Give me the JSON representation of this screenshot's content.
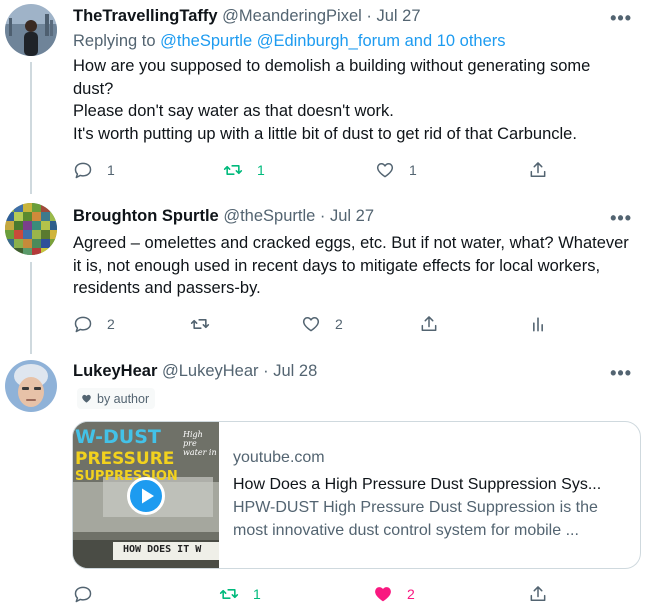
{
  "tweets": [
    {
      "name": "TheTravellingTaffy",
      "handle": "@MeanderingPixel",
      "separator": "·",
      "date": "Jul 27",
      "replying_prefix": "Replying to",
      "replying_to": "@theSpurtle @Edinburgh_forum and 10 others",
      "lines": [
        "How are you supposed to demolish a building without generating some dust?",
        "Please don't say water as that doesn't work.",
        "It's worth putting up with a little bit of dust to get rid of that Carbuncle."
      ],
      "reply_count": "1",
      "retweet_count": "1",
      "like_count": "1"
    },
    {
      "name": "Broughton Spurtle",
      "handle": "@theSpurtle",
      "separator": "·",
      "date": "Jul 27",
      "lines": [
        "Agreed – omelettes and cracked eggs, etc. But if not water, what? Whatever it is, not enough used in recent days to mitigate effects for local workers, residents and passers-by."
      ],
      "reply_count": "2",
      "retweet_count": "",
      "like_count": "2"
    },
    {
      "name": "LukeyHear",
      "handle": "@LukeyHear",
      "separator": "·",
      "date": "Jul 28",
      "badge": "by author",
      "card": {
        "domain": "youtube.com",
        "title": "How Does a High Pressure Dust Suppression Sys...",
        "description": "HPW-DUST High Pressure Dust Suppression is the most innovative dust control system for mobile ...",
        "thumb_title_1": "W-DUST",
        "thumb_title_2": "PRESSURE",
        "thumb_title_3": "SUPPRESSION",
        "thumb_side": "High pre water in",
        "thumb_bottom": "HOW DOES IT W"
      },
      "reply_count": "",
      "retweet_count": "1",
      "like_count": "2"
    }
  ],
  "more_glyph": "•••",
  "colors": {
    "link": "#1d9bf0",
    "retweet": "#00ba7c",
    "liked": "#f91880",
    "secondary": "#536471"
  }
}
